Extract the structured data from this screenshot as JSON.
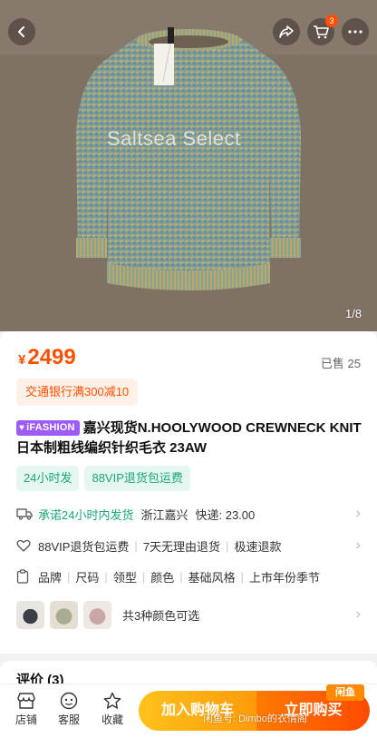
{
  "header": {
    "cart_badge": "3",
    "icons": [
      "back-icon",
      "share-icon",
      "cart-icon",
      "more-icon"
    ]
  },
  "gallery": {
    "watermark": "Saltsea Select",
    "page_indicator": "1/8"
  },
  "price": {
    "symbol": "¥",
    "value": "2499",
    "sold": "已售 25",
    "promo": "交通银行满300减10"
  },
  "product": {
    "badge": "iFASHION",
    "title": "嘉兴现货N.HOOLYWOOD CREWNECK KNIT日本制粗线编织针织毛衣 23AW"
  },
  "service_tags": [
    "24小时发",
    "88VIP退货包运费"
  ],
  "shipping": {
    "promise": "承诺24小时内发货",
    "origin": "浙江嘉兴",
    "fee": "快递: 23.00"
  },
  "guarantees": [
    "88VIP退货包运费",
    "7天无理由退货",
    "极速退款"
  ],
  "specs": [
    "品牌",
    "尺码",
    "领型",
    "颜色",
    "基础风格",
    "上市年份季节"
  ],
  "colors": {
    "text": "共3种颜色可选"
  },
  "reviews": {
    "title": "评价 (3)"
  },
  "bottom_nav": {
    "store": "店铺",
    "service": "客服",
    "favorite": "收藏",
    "add_to_cart": "加入购物车",
    "buy_now": "立即购买"
  },
  "overlay": {
    "xianyu_badge": "闲鱼",
    "xianyu_watermark": "闲鱼号: Dimbo的衣情阁"
  },
  "colors_theme": {
    "accent": "#ff5000",
    "green": "#1aa67a",
    "ifashion": "#9c5cf5"
  }
}
